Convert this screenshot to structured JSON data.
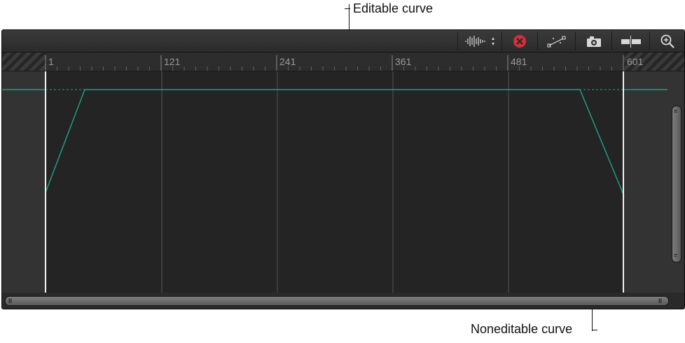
{
  "callouts": {
    "editable": "Editable curve",
    "noneditable": "Noneditable curve"
  },
  "toolbar": {
    "buttons": [
      {
        "name": "audio-waveform-button",
        "icon": "waveform-icon"
      },
      {
        "name": "clear-curves-button",
        "icon": "close-circle-icon"
      },
      {
        "name": "curve-edit-button",
        "icon": "bezier-curve-icon"
      },
      {
        "name": "snapshot-button",
        "icon": "camera-icon"
      },
      {
        "name": "fit-range-button",
        "icon": "range-icon"
      },
      {
        "name": "zoom-button",
        "icon": "zoom-icon"
      }
    ]
  },
  "ruler": {
    "ticks": [
      "1",
      "121",
      "241",
      "361",
      "481",
      "601"
    ]
  },
  "colors": {
    "curve": "#1f9c86",
    "grid": "#555555",
    "background": "#242424"
  }
}
